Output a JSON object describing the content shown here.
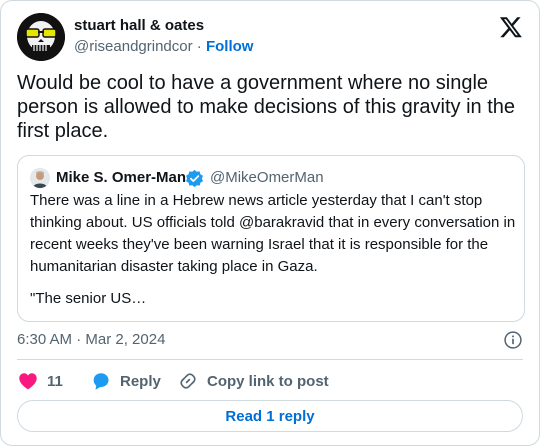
{
  "author": {
    "name": "stuart hall & oates",
    "handle": "@riseandgrindcor",
    "separator": "·",
    "follow_label": "Follow"
  },
  "tweet": {
    "text": "Would be cool to have a government where no single person is allowed to make decisions of this gravity in the first place."
  },
  "quote": {
    "name": "Mike S. Omer-Man",
    "handle": "@MikeOmerMan",
    "text": "There was a line in a Hebrew news article yesterday that I can't stop thinking about. US officials told @barakravid that in every conversation in recent weeks they've been warning Israel that it is responsible for the humanitarian disaster taking place in Gaza.",
    "more": "\"The senior US…"
  },
  "meta": {
    "timestamp": "6:30 AM · Mar 2, 2024"
  },
  "actions": {
    "like_count": "11",
    "reply_label": "Reply",
    "copy_label": "Copy link to post"
  },
  "read_replies_label": "Read 1 reply",
  "colors": {
    "like": "#f91880",
    "reply": "#1d9bf0",
    "link": "#006fd6",
    "verified": "#1d9bf0",
    "text": "#0f1419",
    "muted": "#536471",
    "border": "#cfd9de"
  },
  "icons": {
    "x_logo": "x-logo-icon",
    "verified": "verified-badge-icon",
    "info": "info-icon",
    "like": "heart-icon",
    "reply": "speech-bubble-icon",
    "copy": "link-icon"
  }
}
